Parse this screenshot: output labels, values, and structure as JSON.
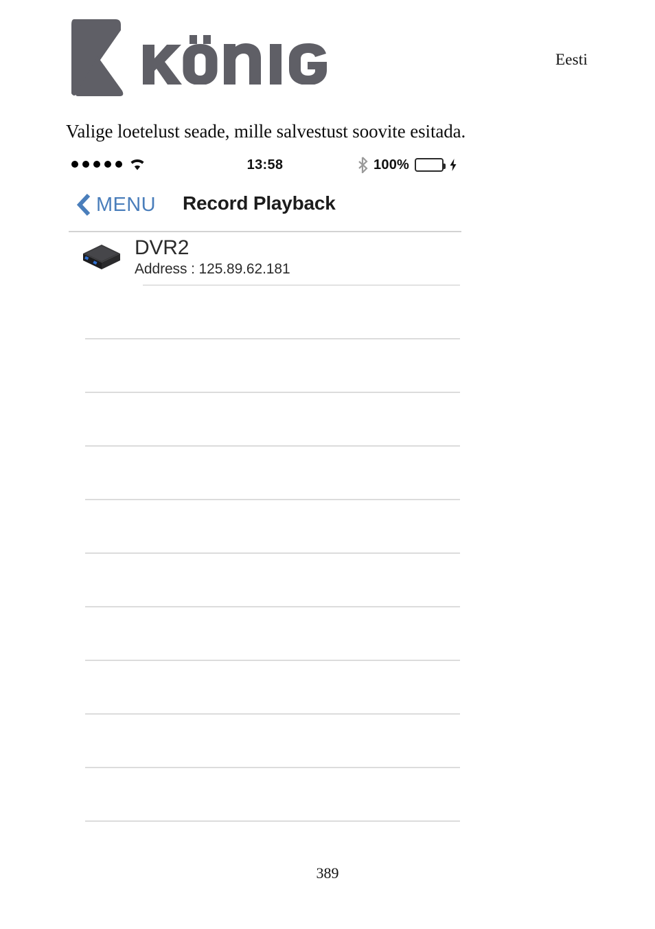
{
  "document": {
    "language_label": "Eesti",
    "instruction": "Valige loetelust seade, mille salvestust soovite esitada.",
    "page_number": "389",
    "logo": {
      "mark_name": "konig-k-mark",
      "wordmark": "KÖNIG",
      "color": "#5f5f66"
    }
  },
  "screenshot": {
    "status_bar": {
      "signal_dots": 5,
      "wifi_icon": "wifi-icon",
      "time": "13:58",
      "bluetooth_icon": "bluetooth-icon",
      "battery_percent": "100%",
      "battery_level": 100,
      "battery_color": "#5ece5b",
      "charging_icon": "lightning-bolt-icon"
    },
    "nav_bar": {
      "back_icon": "chevron-left-icon",
      "back_label": "MENU",
      "back_color": "#4a7ebb",
      "title": "Record Playback"
    },
    "device_list": {
      "devices": [
        {
          "icon": "dvr-device-icon",
          "name": "DVR2",
          "address": "Address : 125.89.62.181"
        }
      ],
      "empty_row_count": 10
    }
  }
}
